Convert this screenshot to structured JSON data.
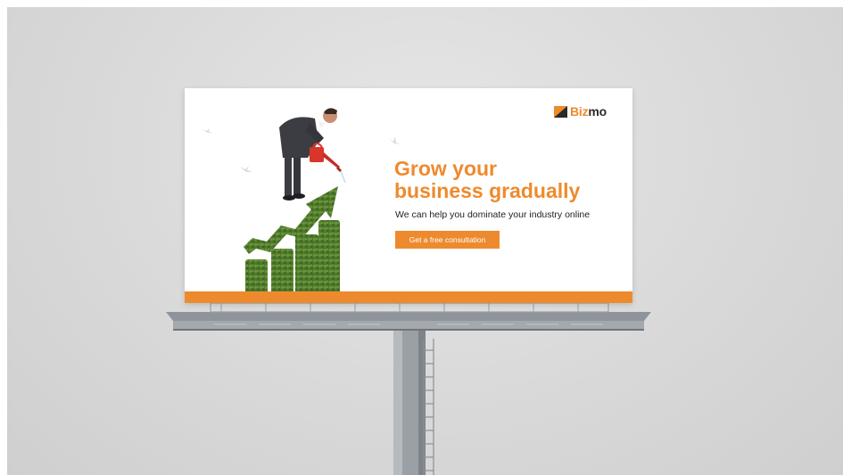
{
  "billboard": {
    "brand": {
      "name_part1": "Biz",
      "name_part2": "mo",
      "accent_color": "#ee8a2e",
      "dark_color": "#2a2a2a"
    },
    "headline_line1": "Grow your",
    "headline_line2": "business gradually",
    "subline": "We can help you dominate your industry online",
    "cta_label": "Get a free consultation",
    "colors": {
      "strip": "#ee8a2e",
      "panel": "#ffffff",
      "hedge": "#4f7a2c",
      "watering_can": "#d8362b",
      "suit": "#3b3d42"
    }
  },
  "background": {
    "color": "#d9d9d9"
  }
}
